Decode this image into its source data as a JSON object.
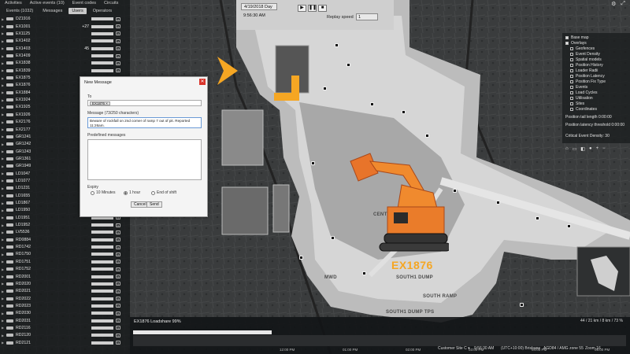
{
  "top_menu": [
    "Activities",
    "Active events (10)",
    "Event codes",
    "Circuits"
  ],
  "tabs": [
    {
      "label": "Events (1032)",
      "active": false
    },
    {
      "label": "Messages",
      "active": false
    },
    {
      "label": "Users",
      "active": true
    },
    {
      "label": "Operators",
      "active": false
    }
  ],
  "assets": [
    {
      "name": "DZ1916",
      "value": "",
      "bar": "#cfcfcf"
    },
    {
      "name": "EX1001",
      "value": "+27",
      "bar": "#cfcfcf"
    },
    {
      "name": "EX1125",
      "value": "",
      "bar": "#cfcfcf"
    },
    {
      "name": "EX1402",
      "value": "",
      "bar": "#cfcfcf"
    },
    {
      "name": "EX1403",
      "value": "45",
      "bar": "#cfcfcf"
    },
    {
      "name": "EX1409",
      "value": "",
      "bar": "#cfcfcf"
    },
    {
      "name": "EX1838",
      "value": "",
      "bar": "#cfcfcf"
    },
    {
      "name": "EX1839",
      "value": "",
      "bar": "#cfcfcf"
    },
    {
      "name": "EX1875",
      "value": "",
      "bar": "#cfcfcf"
    },
    {
      "name": "EX1876",
      "value": "",
      "bar": "#cfcfcf"
    },
    {
      "name": "EX1884",
      "value": "",
      "bar": "#cfcfcf"
    },
    {
      "name": "EX1924",
      "value": "",
      "bar": "#cfcfcf"
    },
    {
      "name": "EX1925",
      "value": "",
      "bar": "#cfcfcf"
    },
    {
      "name": "EX1926",
      "value": "",
      "bar": "#cfcfcf"
    },
    {
      "name": "EX2176",
      "value": "",
      "bar": "#cfcfcf"
    },
    {
      "name": "EX2177",
      "value": "",
      "bar": "#cfcfcf"
    },
    {
      "name": "GR1241",
      "value": "",
      "bar": "#cfcfcf"
    },
    {
      "name": "GR1242",
      "value": "",
      "bar": "#cfcfcf"
    },
    {
      "name": "GR1243",
      "value": "",
      "bar": "#cfcfcf"
    },
    {
      "name": "GR1361",
      "value": "",
      "bar": "#cfcfcf"
    },
    {
      "name": "GR1949",
      "value": "",
      "bar": "#cfcfcf"
    },
    {
      "name": "LD1047",
      "value": "",
      "bar": "#cfcfcf"
    },
    {
      "name": "LD1077",
      "value": "",
      "bar": "#cfcfcf"
    },
    {
      "name": "LD1231",
      "value": "",
      "bar": "#cfcfcf"
    },
    {
      "name": "LD1655",
      "value": "",
      "bar": "#cfcfcf"
    },
    {
      "name": "LD1867",
      "value": "",
      "bar": "#cfcfcf"
    },
    {
      "name": "LD1950",
      "value": "",
      "bar": "#cfcfcf"
    },
    {
      "name": "LD1951",
      "value": "",
      "bar": "#cfcfcf"
    },
    {
      "name": "LD1952",
      "value": "",
      "bar": "#cfcfcf"
    },
    {
      "name": "LV5536",
      "value": "",
      "bar": "#cfcfcf"
    },
    {
      "name": "RD0884",
      "value": "",
      "bar": "#cfcfcf"
    },
    {
      "name": "RD1742",
      "value": "",
      "bar": "#cfcfcf"
    },
    {
      "name": "RD1750",
      "value": "",
      "bar": "#cfcfcf"
    },
    {
      "name": "RD1751",
      "value": "",
      "bar": "#cfcfcf"
    },
    {
      "name": "RD1752",
      "value": "",
      "bar": "#cfcfcf"
    },
    {
      "name": "RD2001",
      "value": "",
      "bar": "#cfcfcf"
    },
    {
      "name": "RD2020",
      "value": "",
      "bar": "#cfcfcf"
    },
    {
      "name": "RD2021",
      "value": "",
      "bar": "#cfcfcf"
    },
    {
      "name": "RD2022",
      "value": "",
      "bar": "#cfcfcf"
    },
    {
      "name": "RD2023",
      "value": "",
      "bar": "#cfcfcf"
    },
    {
      "name": "RD2030",
      "value": "",
      "bar": "#cfcfcf"
    },
    {
      "name": "RD2031",
      "value": "",
      "bar": "#cfcfcf"
    },
    {
      "name": "RD2116",
      "value": "",
      "bar": "#cfcfcf"
    },
    {
      "name": "RD2120",
      "value": "",
      "bar": "#cfcfcf"
    },
    {
      "name": "RD2121",
      "value": "",
      "bar": "#cfcfcf"
    }
  ],
  "toolbar": {
    "date": "4/19/2018 Day",
    "time": "9:56:30 AM",
    "replay_label": "Replay speed",
    "replay_value": "1"
  },
  "dialog": {
    "title": "New Message",
    "to_label": "To",
    "to_chip": "EX1876",
    "message_label": "Message (73/250 characters)",
    "message_text": "Beware of rockfall on 2nd corner of ramp 7 out of pit. Reported 11:26am.",
    "predefined_label": "Predefined messages",
    "expiry_label": "Expiry",
    "expiry_options": [
      "10 Minutes",
      "1 hour",
      "End of shift"
    ],
    "expiry_selected": 1,
    "cancel": "Cancel",
    "send": "Send"
  },
  "overlays": {
    "base_map": "Base map",
    "overlays": "Overlays",
    "items": [
      "Geofences",
      "Event Density",
      "Spatial models",
      "Position History",
      "Loader Radii",
      "Position Latency",
      "Position Fix Type",
      "Events",
      "Load Cycles",
      "Utilisation",
      "Sites",
      "Coordinates"
    ],
    "tail_length": "Position tail length 0:00:00",
    "latency": "Position latency threshold 0:00:00",
    "critical": "Critical Event Density: 30"
  },
  "map_labels": {
    "central": "CENTRAL",
    "mwd": "MWD",
    "south1_dump": "SOUTH1 DUMP",
    "south_ramp": "SOUTH RAMP",
    "south1_dump_tps": "SOUTH1 DUMP TPS"
  },
  "excavator": {
    "id": "EX1876"
  },
  "bottom": {
    "header": "EX1876   Loadshare 99%",
    "ticks": [
      "12:00 PM",
      "01:00 PM",
      "02:00 PM",
      "03:00 PM",
      "04:00 PM",
      "05:00 PM"
    ],
    "site": "Customer Site C ▾",
    "time": "9:56:30 AM",
    "timezone": "(UTC+10:00) Brisbane",
    "datum": "AGD84 / AMG zone 55",
    "zoom": "Zoom 16",
    "coords": "44 / 21 km / 8 km / 73 %"
  },
  "colors": {
    "accent": "#f5a623",
    "panel": "#16181a",
    "dialog_bg": "#f4f4f4"
  }
}
